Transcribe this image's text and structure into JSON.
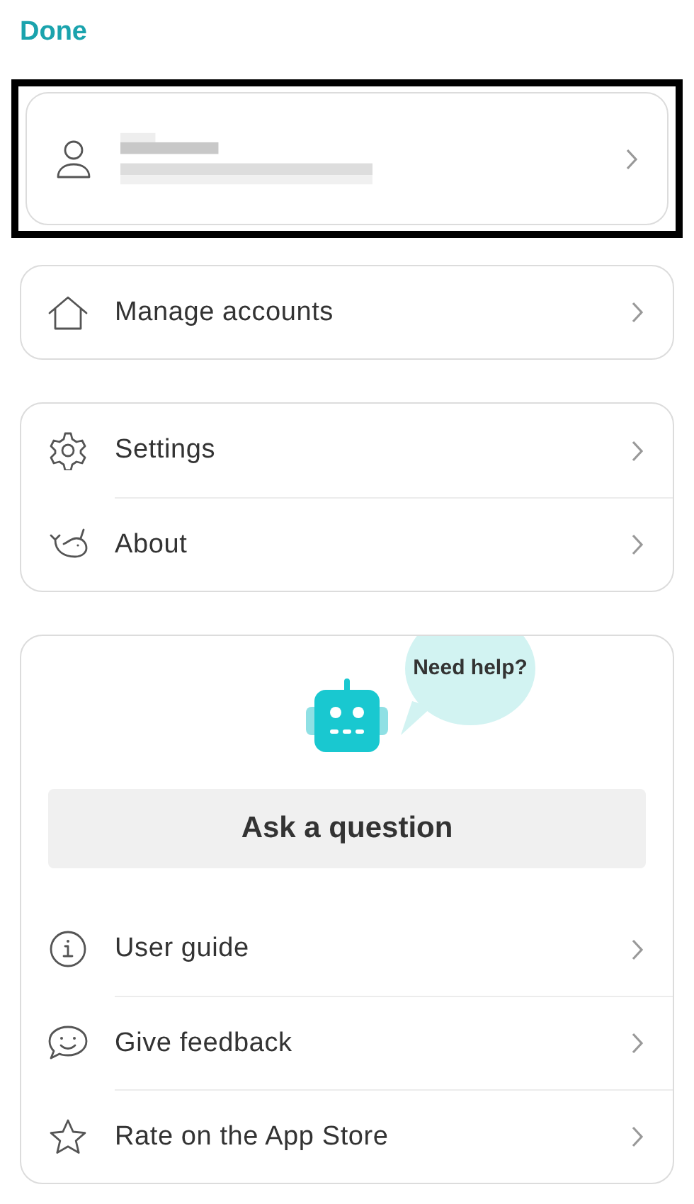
{
  "header": {
    "done": "Done"
  },
  "profile": {
    "highlighted": true
  },
  "accounts": [
    {
      "label": "Manage accounts"
    }
  ],
  "general": [
    {
      "label": "Settings"
    },
    {
      "label": "About"
    }
  ],
  "help": {
    "bubble": "Need help?",
    "ask": "Ask a question",
    "items": [
      {
        "label": "User guide"
      },
      {
        "label": "Give feedback"
      },
      {
        "label": "Rate on the App Store"
      }
    ]
  }
}
